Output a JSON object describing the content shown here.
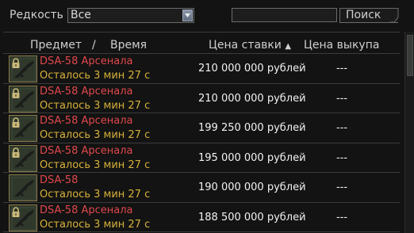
{
  "filters": {
    "rarity_label": "Редкость",
    "rarity_selected": "Все",
    "search_value": "",
    "search_button": "Поиск"
  },
  "table": {
    "headers": {
      "item": "Предмет",
      "separator": "/",
      "time": "Время",
      "bid_price": "Цена ставки",
      "sort_indicator": "▲",
      "buyout_price": "Цена выкупа"
    },
    "rows": [
      {
        "name": "DSA-58 Арсенала",
        "time_left": "Осталось 3 мин 27 с",
        "bid_price": "210 000 000 рублей",
        "buyout_price": "---",
        "locked": true
      },
      {
        "name": "DSA-58 Арсенала",
        "time_left": "Осталось 3 мин 27 с",
        "bid_price": "210 000 000 рублей",
        "buyout_price": "---",
        "locked": true
      },
      {
        "name": "DSA-58 Арсенала",
        "time_left": "Осталось 3 мин 27 с",
        "bid_price": "199 250 000 рублей",
        "buyout_price": "---",
        "locked": true
      },
      {
        "name": "DSA-58 Арсенала",
        "time_left": "Осталось 3 мин 27 с",
        "bid_price": "195 000 000 рублей",
        "buyout_price": "---",
        "locked": true
      },
      {
        "name": "DSA-58",
        "time_left": "Осталось 3 мин 27 с",
        "bid_price": "190 000 000 рублей",
        "buyout_price": "---",
        "locked": false
      },
      {
        "name": "DSA-58 Арсенала",
        "time_left": "Осталось 3 мин 27 с",
        "bid_price": "188 500 000 рублей",
        "buyout_price": "---",
        "locked": true
      }
    ]
  },
  "colors": {
    "item_name": "#e2474d",
    "time_left": "#d8b13a",
    "price": "#f2f2f2"
  },
  "icons": {
    "dropdown": "chevron-down-icon",
    "item": "rifle-icon",
    "lock": "lock-icon"
  }
}
